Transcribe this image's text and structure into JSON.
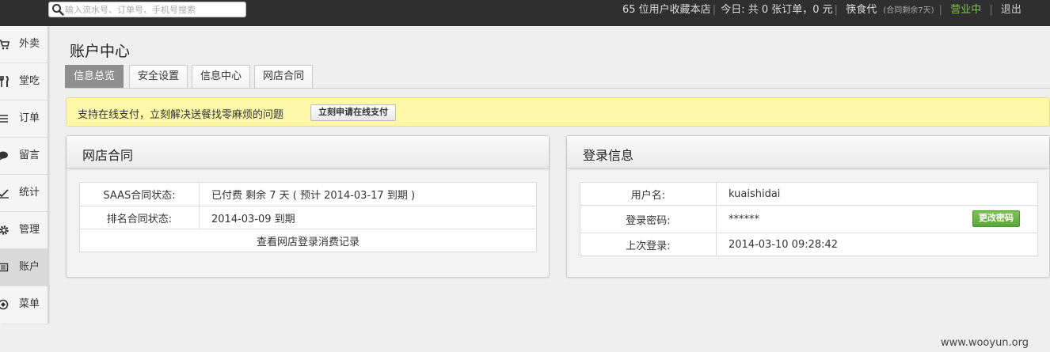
{
  "topbar": {
    "search_placeholder": "输入流水号、订单号、手机号搜索",
    "favorites_text": "65 位用户收藏本店",
    "today_text": "今日: 共 0 张订单，0 元",
    "shop_name": "筷食代",
    "contract_note": "(合同剩余7天)",
    "status": "营业中",
    "logout": "退出",
    "status_color": "#7bc14a"
  },
  "sidebar": {
    "items": [
      {
        "label": "外卖",
        "icon": "cart-icon"
      },
      {
        "label": "堂吃",
        "icon": "fork-knife-icon"
      },
      {
        "label": "订单",
        "icon": "list-icon"
      },
      {
        "label": "留言",
        "icon": "speech-bubble-icon"
      },
      {
        "label": "统计",
        "icon": "chart-icon"
      },
      {
        "label": "管理",
        "icon": "gear-icon"
      },
      {
        "label": "账户",
        "icon": "card-icon",
        "active": true
      },
      {
        "label": "菜单",
        "icon": "dish-icon"
      }
    ]
  },
  "page": {
    "title": "账户中心",
    "tabs": [
      {
        "label": "信息总览",
        "active": true
      },
      {
        "label": "安全设置"
      },
      {
        "label": "信息中心"
      },
      {
        "label": "网店合同"
      }
    ],
    "notice": {
      "text": "支持在线支付，立刻解决送餐找零麻烦的问题",
      "button": "立刻申请在线支付",
      "bg_color": "#fdf8a8"
    }
  },
  "contract_panel": {
    "title": "网店合同",
    "rows": [
      {
        "label": "SAAS合同状态:",
        "value": "已付费 剩余 7 天 ( 预计 2014-03-17 到期 )"
      },
      {
        "label": "排名合同状态:",
        "value": "2014-03-09 到期"
      }
    ],
    "footer_link": "查看网店登录消费记录"
  },
  "login_panel": {
    "title": "登录信息",
    "rows": [
      {
        "label": "用户名:",
        "value": "kuaishidai"
      },
      {
        "label": "登录密码:",
        "value": "******"
      },
      {
        "label": "上次登录:",
        "value": "2014-03-10 09:28:42"
      }
    ],
    "change_password_button": "更改密码",
    "button_color": "#6cb846"
  },
  "watermark": "www.wooyun.org"
}
